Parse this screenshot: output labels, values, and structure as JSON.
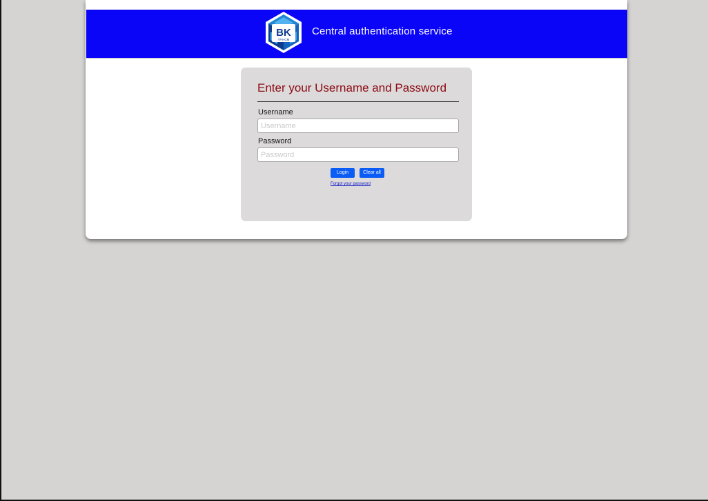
{
  "header": {
    "logo_text": "BK",
    "logo_subtext": "TP.HCM",
    "service_title": "Central authentication service"
  },
  "login": {
    "heading": "Enter your Username and Password",
    "username_label": "Username",
    "username_placeholder": "Username",
    "username_value": "",
    "password_label": "Password",
    "password_placeholder": "Password",
    "password_value": "",
    "login_button": "Login",
    "clear_button": "Clear all",
    "forgot_link": "Forgot your password"
  },
  "colors": {
    "banner": "#0a05f7",
    "heading": "#8c0a12",
    "button": "#0b5cf5",
    "link": "#1a22c8",
    "background": "#d5d4d2",
    "login_box": "#dcdadb"
  }
}
